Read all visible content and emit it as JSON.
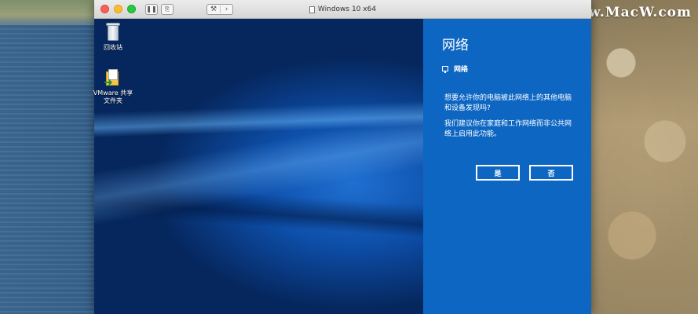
{
  "host": {
    "watermark": "www.MacW.com"
  },
  "vm_window": {
    "title": "Windows 10 x64",
    "buttons": {
      "pause": "❚❚",
      "snapshot": "⎘",
      "settings": "⚒",
      "forward": "›"
    }
  },
  "desktop": {
    "icons": [
      {
        "label": "回收站",
        "icon": "recycle-bin-icon"
      },
      {
        "label": "VMware 共享\n文件夹",
        "icon": "shared-folder-icon"
      }
    ]
  },
  "network_panel": {
    "title": "网络",
    "network_name": "网络",
    "network_icon": "network-monitor-icon",
    "question": "想要允许你的电脑被此网络上的其他电脑和设备发现吗?",
    "recommendation": "我们建议你在家庭和工作网络而非公共网络上启用此功能。",
    "yes_label": "是",
    "no_label": "否"
  },
  "colors": {
    "panel_blue": "#0d66c2",
    "close": "#fc5f57",
    "minimize": "#fdbc2e",
    "zoom": "#28c840"
  }
}
